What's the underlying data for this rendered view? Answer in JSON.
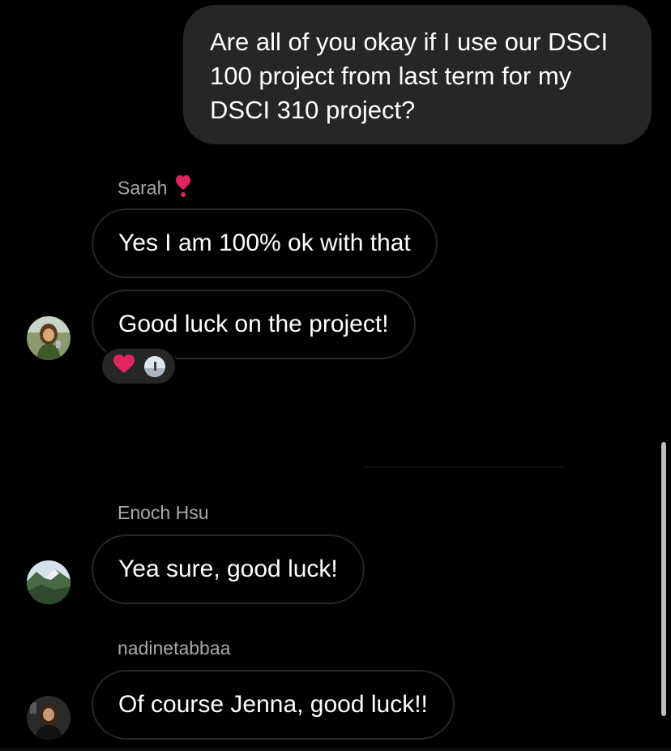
{
  "messages": {
    "sent": "Are all of you okay if I use our DSCI 100 project from last term for my DSCI 310 project?",
    "sarah": {
      "name": "Sarah",
      "name_icon": "heart-exclamation-icon",
      "msg1": "Yes I am 100% ok with that",
      "msg2": "Good luck on the project!",
      "reactions": [
        "red-heart-icon",
        "reactor-avatar"
      ]
    },
    "enoch": {
      "name": "Enoch Hsu",
      "msg1": "Yea sure, good luck!"
    },
    "nadine": {
      "name": "nadinetabbaa",
      "msg1": "Of course Jenna, good luck!!"
    }
  },
  "colors": {
    "background": "#000000",
    "sent_bubble": "#262626",
    "received_border": "#262626",
    "name_text": "#a8a8a8",
    "heart": "#e0245e"
  }
}
